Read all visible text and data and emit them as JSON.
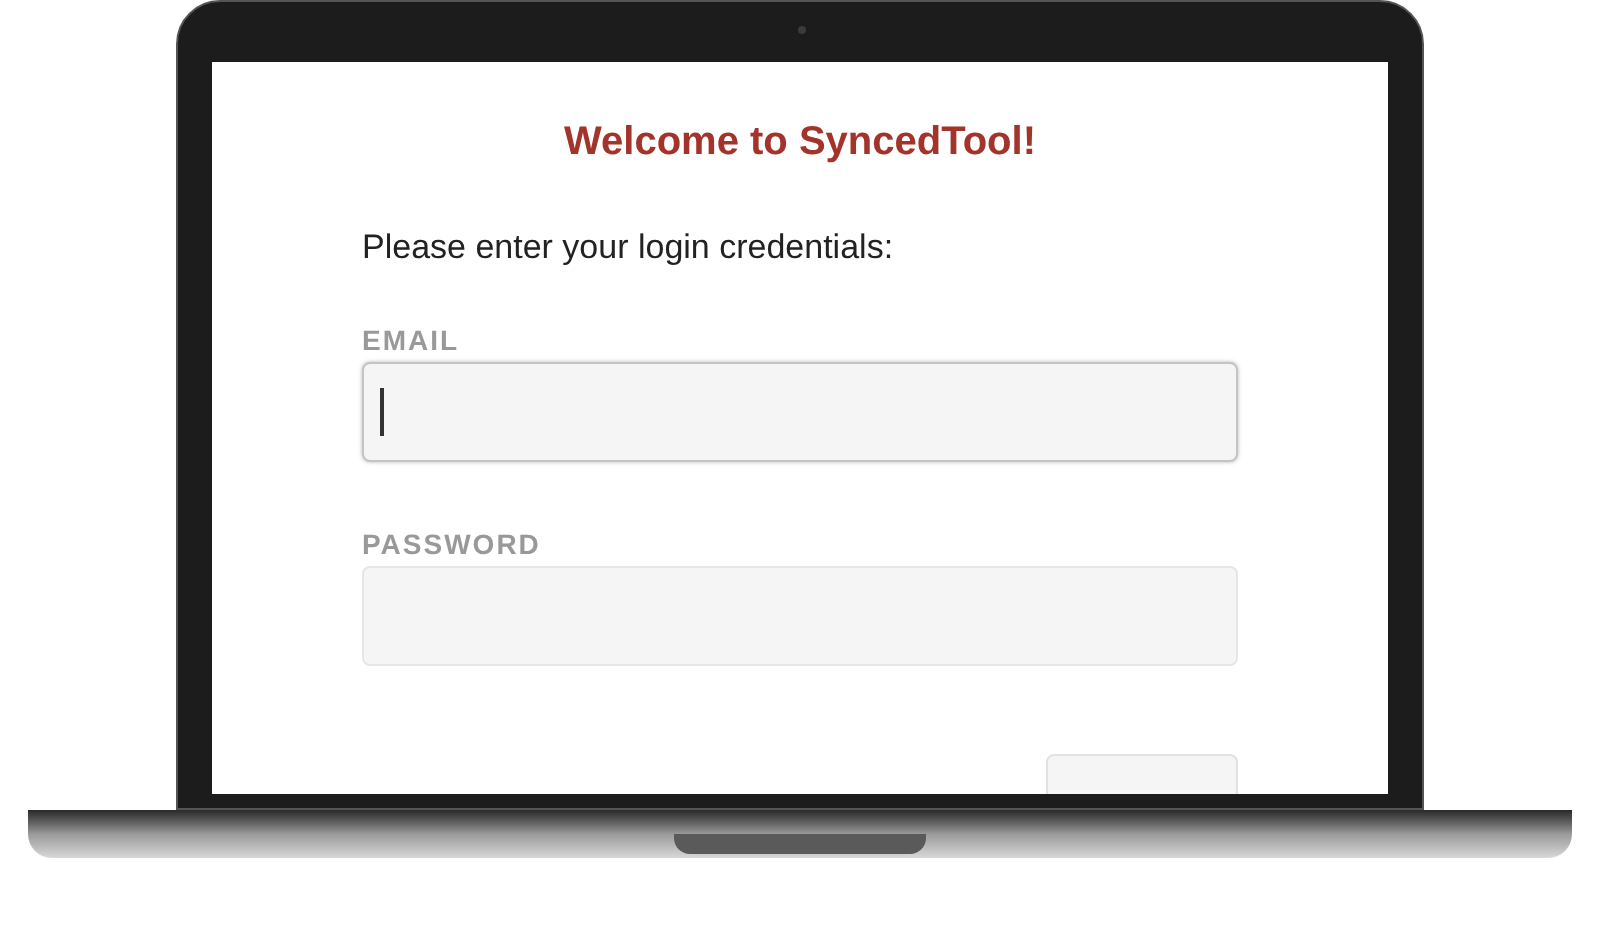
{
  "title": "Welcome to SyncedTool!",
  "prompt": "Please enter your login credentials:",
  "fields": [
    {
      "label": "EMAIL",
      "focused": true
    },
    {
      "label": "PASSWORD",
      "focused": false
    }
  ]
}
